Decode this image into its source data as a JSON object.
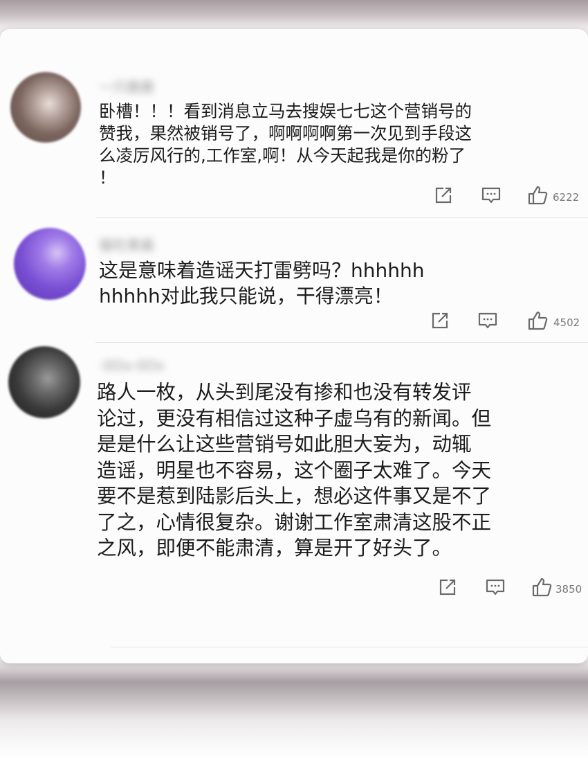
{
  "comments": [
    {
      "username": "一只鹿鹿",
      "text": "卧槽！！！看到消息立马去搜娱七七这个营销号的\n赞我，果然被销号了，啊啊啊啊第一次见到手段这\n么凌厉风行的,工作室,啊！从今天起我是你的粉了\n！",
      "likes": "6222",
      "avatar_color": "#8a7470"
    },
    {
      "username": "猫吃果酱",
      "text": "这是意味着造谣天打雷劈吗？hhhhhh\nhhhhh对此我只能说，干得漂亮！",
      "likes": "4502",
      "avatar_color": "#7a52d0"
    },
    {
      "username": "-0Ox-0Ox",
      "text": " 路人一枚，从头到尾没有掺和也没有转发评\n论过，更没有相信过这种子虚乌有的新闻。但\n是是什么让这些营销号如此胆大妄为，动辄\n造谣，明星也不容易，这个圈子太难了。今天\n要不是惹到陆影后头上，想必这件事又是不了\n了之，心情很复杂。谢谢工作室肃清这股不正\n之风，即便不能肃清，算是开了好头了。",
      "likes": "3850",
      "avatar_color": "#3a3a3a"
    }
  ],
  "icons": {
    "share": "share-icon",
    "reply": "comment-icon",
    "like": "thumbs-up-icon"
  }
}
